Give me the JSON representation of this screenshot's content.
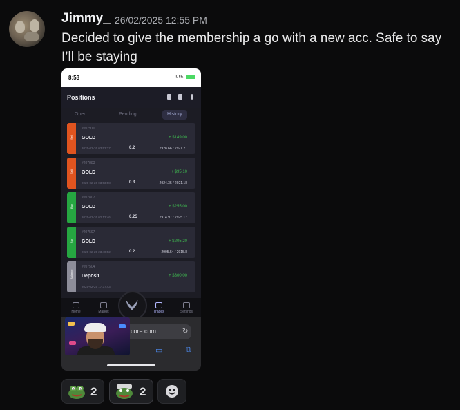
{
  "message": {
    "username": "Jimmy_",
    "timestamp": "26/02/2025 12:55 PM",
    "text": "Decided to give the membership a go with a new acc. Safe to say I’ll be staying"
  },
  "phone": {
    "status_time": "8:53",
    "status_network": "LTE",
    "app_title": "Positions",
    "tabs": [
      "Open",
      "Pending",
      "History"
    ],
    "active_tab": "History",
    "trades": [
      {
        "side": "Sell",
        "id": "#207910",
        "symbol": "GOLD",
        "pl": "+ $149.00",
        "date": "2025-02-26 03:53:27",
        "volume": "0.2",
        "prices": "2928.66 / 2921.21",
        "color": "#e0541f"
      },
      {
        "side": "Sell",
        "id": "#207883",
        "symbol": "GOLD",
        "pl": "+ $95.10",
        "date": "2025-02-26 03:53:58",
        "volume": "0.3",
        "prices": "2924.35 / 2921.18",
        "color": "#e0541f"
      },
      {
        "side": "Buy",
        "id": "#207807",
        "symbol": "GOLD",
        "pl": "+ $255.00",
        "date": "2025-02-26 02:13:46",
        "volume": "0.25",
        "prices": "2914.97 / 2925.17",
        "color": "#26a641"
      },
      {
        "side": "Buy",
        "id": "#207597",
        "symbol": "GOLD",
        "pl": "+ $205.20",
        "date": "2025-02-25 23:40:52",
        "volume": "0.2",
        "prices": "2905.54 / 2915.8",
        "color": "#26a641"
      },
      {
        "side": "Balance",
        "id": "#207504",
        "symbol": "Deposit",
        "pl": "+ $300.00",
        "date": "2025-02-25 17:37:43",
        "volume": "",
        "prices": "",
        "color": "#8d8d99"
      }
    ],
    "nav": [
      "Home",
      "Market",
      "Trades",
      "Settings"
    ],
    "active_nav": "Trades",
    "url": "core.com"
  },
  "reactions": [
    {
      "emoji": "pepe-frog-icon",
      "count": "2"
    },
    {
      "emoji": "pepe-frog-hat-icon",
      "count": "2"
    }
  ],
  "colors": {
    "background": "#0b0b0c",
    "profit": "#3fb950",
    "sell": "#e0541f",
    "buy": "#26a641"
  }
}
